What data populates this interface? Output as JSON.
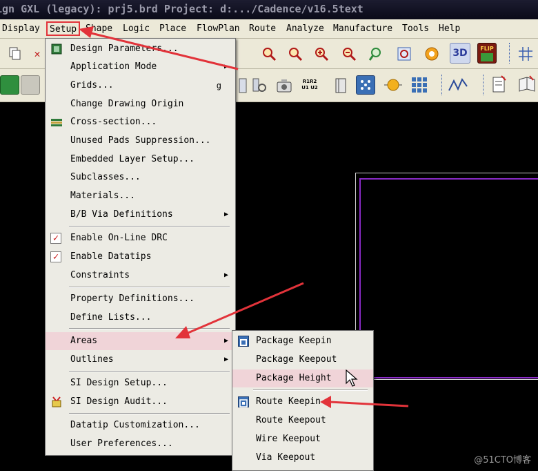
{
  "window": {
    "title": "ign GXL (legacy): prj5.brd  Project: d:.../Cadence/v16.5text"
  },
  "menubar": {
    "items": [
      "Display",
      "Setup",
      "Shape",
      "Logic",
      "Place",
      "FlowPlan",
      "Route",
      "Analyze",
      "Manufacture",
      "Tools",
      "Help"
    ],
    "active": "Setup"
  },
  "toolbar": {
    "flip_label": "FLIP",
    "label_3d": "3D",
    "rats_label_top": "R1R2",
    "rats_label_bottom": "U1 U2"
  },
  "setup_menu": {
    "items": [
      {
        "label": "Design Parameters...",
        "icon": "design-params-icon"
      },
      {
        "label": "Application Mode",
        "submenu": true
      },
      {
        "label": "Grids...",
        "accel": "g"
      },
      {
        "label": "Change Drawing Origin"
      },
      {
        "label": "Cross-section...",
        "icon": "cross-section-icon"
      },
      {
        "label": "Unused Pads Suppression..."
      },
      {
        "label": "Embedded Layer Setup..."
      },
      {
        "label": "Subclasses..."
      },
      {
        "label": "Materials..."
      },
      {
        "label": "B/B Via Definitions",
        "submenu": true
      },
      {
        "label": "Enable On-Line DRC",
        "checked": true
      },
      {
        "label": "Enable Datatips",
        "checked": true
      },
      {
        "label": "Constraints",
        "submenu": true
      },
      {
        "label": "Property Definitions..."
      },
      {
        "label": "Define Lists..."
      },
      {
        "label": "Areas",
        "submenu": true,
        "highlighted": true
      },
      {
        "label": "Outlines",
        "submenu": true
      },
      {
        "label": "SI Design Setup..."
      },
      {
        "label": "SI Design Audit...",
        "icon": "si-audit-icon"
      },
      {
        "label": "Datatip Customization..."
      },
      {
        "label": "User Preferences..."
      }
    ]
  },
  "areas_menu": {
    "items": [
      {
        "label": "Package Keepin",
        "icon": "package-keepin-icon"
      },
      {
        "label": "Package Keepout"
      },
      {
        "label": "Package Height",
        "highlighted": true
      },
      {
        "label": "Route Keepin",
        "icon": "route-keepin-icon"
      },
      {
        "label": "Route Keepout"
      },
      {
        "label": "Wire Keepout"
      },
      {
        "label": "Via Keepout"
      }
    ]
  },
  "watermark": "@51CTO博客",
  "colors": {
    "accent": "#e2333a",
    "menu_bg": "#ecebe4",
    "highlight": "#f0d4d8",
    "board_outline": "#8a2bc8"
  }
}
